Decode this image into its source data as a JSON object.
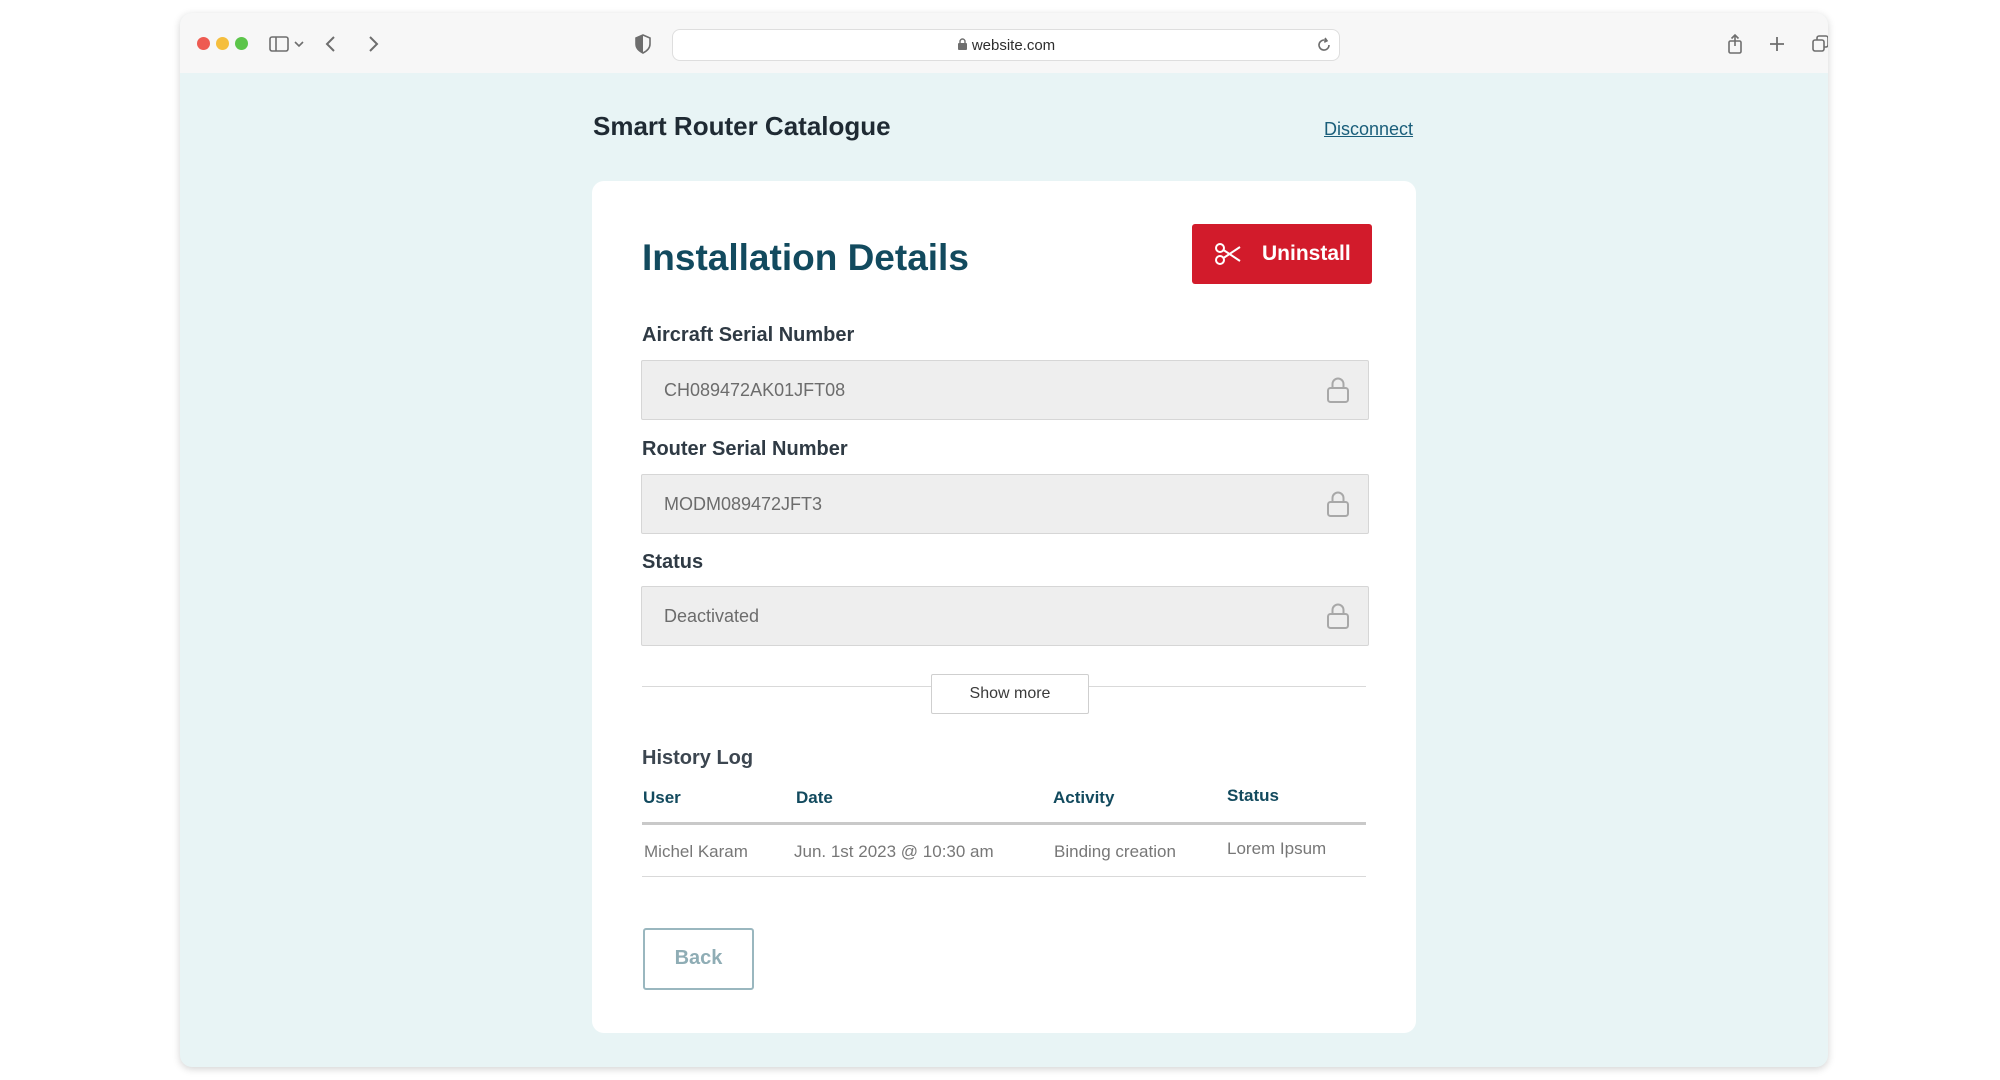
{
  "browser": {
    "url": "website.com"
  },
  "header": {
    "app_title": "Smart Router Catalogue",
    "disconnect_label": "Disconnect"
  },
  "card": {
    "title": "Installation Details",
    "uninstall_label": "Uninstall",
    "fields": [
      {
        "label": "Aircraft Serial Number",
        "value": "CH089472AK01JFT08"
      },
      {
        "label": "Router Serial Number",
        "value": "MODM089472JFT3"
      },
      {
        "label": "Status",
        "value": "Deactivated"
      }
    ],
    "show_more_label": "Show more",
    "history": {
      "title": "History Log",
      "columns": [
        "User",
        "Date",
        "Activity",
        "Status"
      ],
      "rows": [
        [
          "Michel Karam",
          "Jun. 1st 2023 @ 10:30 am",
          "Binding creation",
          "Lorem Ipsum"
        ]
      ]
    },
    "back_label": "Back"
  },
  "colors": {
    "accent_danger": "#d21b2b",
    "heading": "#124a5e",
    "page_bg": "#e8f4f5"
  }
}
